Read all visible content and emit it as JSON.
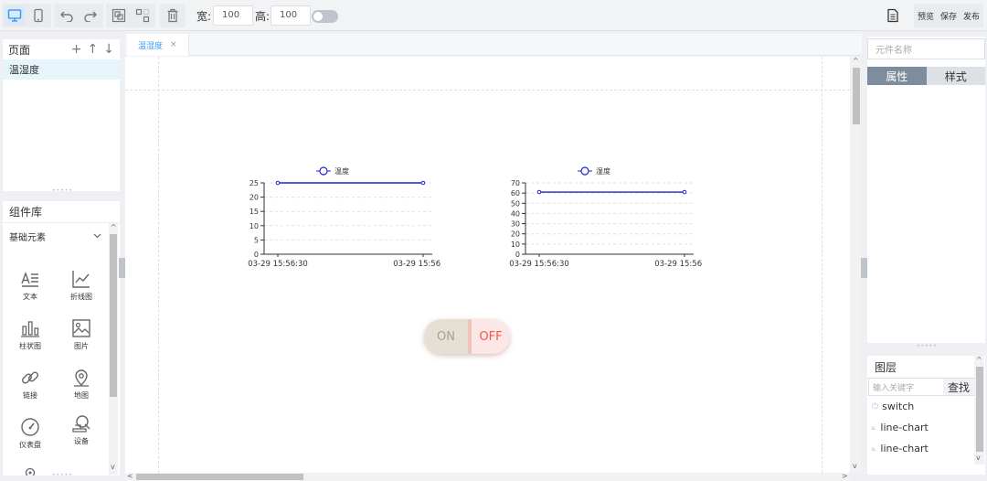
{
  "toolbar": {
    "width_label": "宽:",
    "width_value": "100",
    "height_label": "高:",
    "height_value": "100",
    "preview_label": "预览",
    "save_label": "保存",
    "publish_label": "发布",
    "accent": "#409eff"
  },
  "pages": {
    "title": "页面",
    "add": "+",
    "up": "↑",
    "down": "↓",
    "items": [
      {
        "label": "温湿度"
      }
    ]
  },
  "library": {
    "title": "组件库",
    "category": "基础元素",
    "components": [
      {
        "label": "文本",
        "icon": "text-icon"
      },
      {
        "label": "折线图",
        "icon": "line-chart-icon"
      },
      {
        "label": "柱状图",
        "icon": "bar-chart-icon"
      },
      {
        "label": "图片",
        "icon": "image-icon"
      },
      {
        "label": "链接",
        "icon": "link-icon"
      },
      {
        "label": "地图",
        "icon": "map-pin-icon"
      },
      {
        "label": "仪表盘",
        "icon": "gauge-icon"
      },
      {
        "label": "设备",
        "icon": "device-icon"
      }
    ]
  },
  "tab": {
    "label": "温湿度",
    "close": "×"
  },
  "switch": {
    "on_label": "ON",
    "off_label": "OFF",
    "state": "off"
  },
  "right": {
    "name_placeholder": "元件名称",
    "tab_properties": "属性",
    "tab_style": "样式"
  },
  "layers": {
    "title": "图层",
    "search_placeholder": "输入关键字",
    "search_button": "查找",
    "items": [
      {
        "label": "switch",
        "icon": "power-icon"
      },
      {
        "label": "line-chart",
        "icon": "line-chart-icon"
      },
      {
        "label": "line-chart",
        "icon": "line-chart-icon"
      }
    ]
  },
  "chart_data": [
    {
      "type": "line",
      "legend": "温度",
      "x": [
        "03-29 15:56:30",
        "03-29 15:56:50"
      ],
      "series": [
        {
          "name": "温度",
          "values": [
            25,
            25
          ],
          "color": "#2222cc"
        }
      ],
      "ylim": [
        0,
        25
      ],
      "yticks": [
        0,
        5,
        10,
        15,
        20,
        25
      ],
      "grid": true,
      "legend_position": "top-center"
    },
    {
      "type": "line",
      "legend": "湿度",
      "x": [
        "03-29 15:56:30",
        "03-29 15:56:50"
      ],
      "series": [
        {
          "name": "湿度",
          "values": [
            61,
            61
          ],
          "color": "#2222cc"
        }
      ],
      "ylim": [
        0,
        70
      ],
      "yticks": [
        0,
        10,
        20,
        30,
        40,
        50,
        60,
        70
      ],
      "grid": true,
      "legend_position": "top-center"
    }
  ]
}
